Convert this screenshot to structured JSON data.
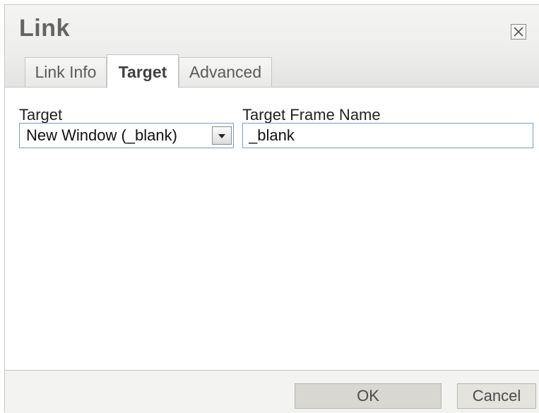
{
  "dialog": {
    "title": "Link",
    "close_icon": "close-icon"
  },
  "tabs": [
    {
      "label": "Link Info",
      "active": false
    },
    {
      "label": "Target",
      "active": true
    },
    {
      "label": "Advanced",
      "active": false
    }
  ],
  "target": {
    "label": "Target",
    "selected": "New Window (_blank)"
  },
  "frame_name": {
    "label": "Target Frame Name",
    "value": "_blank"
  },
  "buttons": {
    "ok": "OK",
    "cancel": "Cancel"
  }
}
